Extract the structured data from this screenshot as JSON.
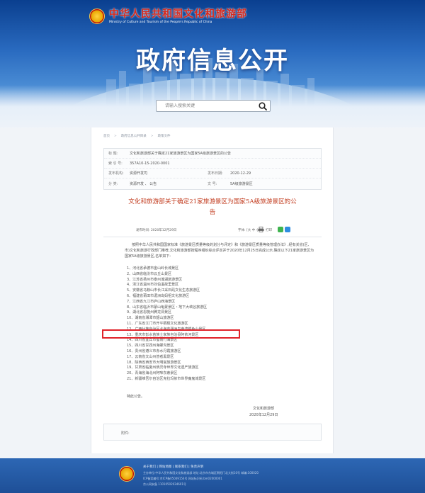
{
  "header": {
    "site_name_cn": "中华人民共和国文化和旅游部",
    "site_name_en": "Ministry of Culture and Tourism of the People's Republic of China",
    "banner_title": "政府信息公开"
  },
  "search": {
    "placeholder": "请输入搜索关键"
  },
  "breadcrumb": [
    "首页",
    "政府信息公开目录",
    "政策文件"
  ],
  "meta": {
    "title_label": "标 题:",
    "title_value": "文化和旅游部关于确定21家旅游景区为国家5A级旅游景区的公告",
    "index_label": "索 引 号:",
    "index_value": "357A10-15-2020-0001",
    "agency_label": "发布机构:",
    "agency_value": "资源开发司",
    "date_label": "发布日期:",
    "date_value": "2020-12-29",
    "category_label": "分 类:",
    "category_value": "资源开发 、 公告",
    "docno_label": "文 号:",
    "docno_value": "5A级旅游景区"
  },
  "document": {
    "title_line1": "文化和旅游部关于确定21家旅游景区为国家5A级旅游景区的公",
    "title_line2": "告",
    "publish_date": "发布时间:  2020年12月29日",
    "font_size": "字体: [大 中 小]",
    "print": "打印",
    "intro": "按照中华人民共和国国家标准《旅游景区质量等级的划分与评定》和《旅游景区质量等级管理办法》,经有关省(区、市)文化和旅游行政部门推荐,文化和旅游部按程序组织综合评定并于2020年12月25日完成公示,确定以下21家旅游景区为国家5A级旅游景区,名单如下:",
    "items": [
      "1、河北省承德市金山岭长城景区",
      "2、山西省临汾市云丘山景区",
      "3、江苏省扬州市泰州溱湖旅游景区",
      "4、浙江省温州市刘伯温故里景区",
      "5、安徽省马鞍山市长江采石矶文化生态旅游区",
      "6、福建省莆田市湄洲岛妈祖文化旅游区",
      "7、江西省九江市庐山西海景区",
      "8、山东省临沂市蒙山龟蒙景区・地下大峡谷旅游区",
      "9、湖北省恩施州腾龙洞景区",
      "10、湖南省湘潭市韶山旅游区",
      "11、广东省江门市开平碉楼文化旅游区",
      "12、广西壮族自治区北海市涠洲岛南湾鳄鱼山景区",
      "13、重庆市彭水苗族土家族自治县阿依河景区",
      "14、四川省宜宾市蜀南竹海景区",
      "15、四川省甘孜州海螺沟景区",
      "16、贵州省遵义市赤水丹霞旅游区",
      "17、云南省文山州普者黑景区",
      "18、陕西省西安市大明宫旅游景区",
      "19、甘肃省临夏州炳灵寺世界文化遗产旅游区",
      "20、青海省海北州阿咪东索景区",
      "21、新疆维吾尔自治区克拉玛依市世界魔鬼城景区"
    ],
    "closing": "特此公告。",
    "sign_org": "文化和旅游部",
    "sign_date": "2020年12月29日"
  },
  "attachment": {
    "label": "附件:"
  },
  "footer": {
    "links": "关于我们  |  网站地图  |  联系我们  |  免责声明",
    "line1": "主办单位:中华人民共和国文化和旅游部    地址:北京市东城区朝阳门北大街10号    邮编:100020",
    "line2": "ICP备案编号:京ICP备05049154号    网站标识码:bm02000001",
    "line3": "京公网安备 11010502034601号"
  },
  "colors": {
    "header_blue": "#0a3f8f",
    "title_red": "#c23b1e",
    "highlight_red": "#e0232a",
    "footer_blue": "#1e4f97"
  }
}
